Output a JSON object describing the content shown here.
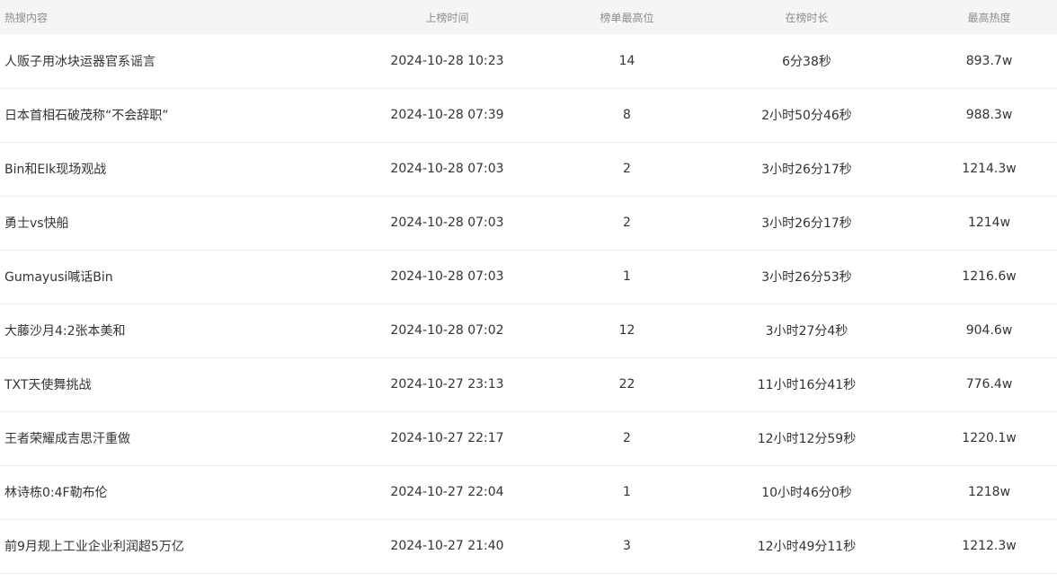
{
  "table": {
    "headers": {
      "topic": "热搜内容",
      "time": "上榜时间",
      "rank": "榜单最高位",
      "duration": "在榜时长",
      "heat": "最高热度"
    },
    "rows": [
      {
        "topic": "人贩子用冰块运器官系谣言",
        "time": "2024-10-28 10:23",
        "rank": "14",
        "duration": "6分38秒",
        "heat": "893.7w"
      },
      {
        "topic": "日本首相石破茂称“不会辞职”",
        "time": "2024-10-28 07:39",
        "rank": "8",
        "duration": "2小时50分46秒",
        "heat": "988.3w"
      },
      {
        "topic": "Bin和Elk现场观战",
        "time": "2024-10-28 07:03",
        "rank": "2",
        "duration": "3小时26分17秒",
        "heat": "1214.3w"
      },
      {
        "topic": "勇士vs快船",
        "time": "2024-10-28 07:03",
        "rank": "2",
        "duration": "3小时26分17秒",
        "heat": "1214w"
      },
      {
        "topic": "Gumayusi喊话Bin",
        "time": "2024-10-28 07:03",
        "rank": "1",
        "duration": "3小时26分53秒",
        "heat": "1216.6w"
      },
      {
        "topic": "大藤沙月4:2张本美和",
        "time": "2024-10-28 07:02",
        "rank": "12",
        "duration": "3小时27分4秒",
        "heat": "904.6w"
      },
      {
        "topic": "TXT天使舞挑战",
        "time": "2024-10-27 23:13",
        "rank": "22",
        "duration": "11小时16分41秒",
        "heat": "776.4w"
      },
      {
        "topic": "王者荣耀成吉思汗重做",
        "time": "2024-10-27 22:17",
        "rank": "2",
        "duration": "12小时12分59秒",
        "heat": "1220.1w"
      },
      {
        "topic": "林诗栋0:4F勒布伦",
        "time": "2024-10-27 22:04",
        "rank": "1",
        "duration": "10小时46分0秒",
        "heat": "1218w"
      },
      {
        "topic": "前9月规上工业企业利润超5万亿",
        "time": "2024-10-27 21:40",
        "rank": "3",
        "duration": "12小时49分11秒",
        "heat": "1212.3w"
      }
    ]
  }
}
